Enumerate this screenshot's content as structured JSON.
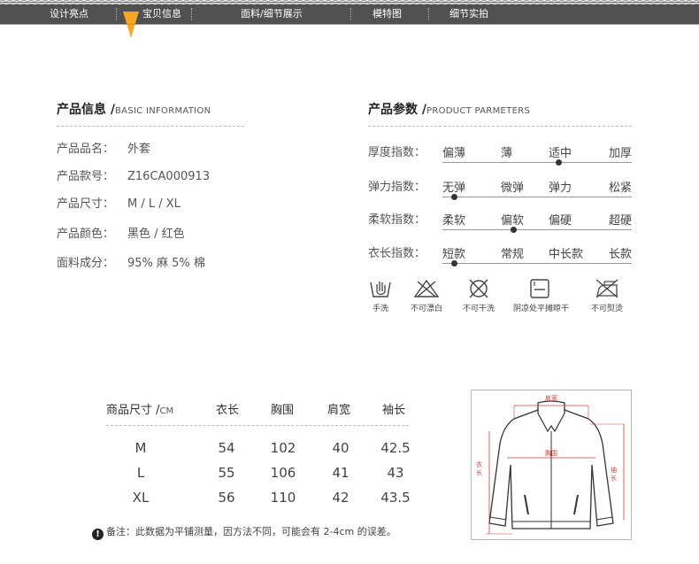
{
  "nav": {
    "items": [
      "设计亮点",
      "宝贝信息",
      "面料/细节展示",
      "模特图",
      "细节实拍"
    ],
    "active_index": 1
  },
  "basic_info": {
    "title": "产品信息 /",
    "subtitle": "BASIC INFORMATION",
    "rows": [
      {
        "label": "产品品名：",
        "value": "外套"
      },
      {
        "label": "产品款号：",
        "value": "Z16CA000913"
      },
      {
        "label": "产品尺寸：",
        "value": "M / L / XL"
      },
      {
        "label": "产品颜色：",
        "value": "黑色 / 红色"
      },
      {
        "label": "面料成分：",
        "value": "95% 麻 5% 棉"
      }
    ]
  },
  "product_params": {
    "title": "产品参数 /",
    "subtitle": "PRODUCT PARMETERS",
    "rows": [
      {
        "label": "厚度指数：",
        "options": [
          "偏薄",
          "薄",
          "适中",
          "加厚"
        ],
        "selected_index": 2
      },
      {
        "label": "弹力指数：",
        "options": [
          "无弹",
          "微弹",
          "弹力",
          "松紧"
        ],
        "selected_index": 0
      },
      {
        "label": "柔软指数：",
        "options": [
          "柔软",
          "偏软",
          "偏硬",
          "超硬"
        ],
        "selected_index": 1
      },
      {
        "label": "衣长指数：",
        "options": [
          "短款",
          "常规",
          "中长款",
          "长款"
        ],
        "selected_index": 0
      }
    ]
  },
  "care": [
    {
      "icon": "hand-wash-icon",
      "label": "手洗"
    },
    {
      "icon": "no-bleach-icon",
      "label": "不可漂白"
    },
    {
      "icon": "no-dry-clean-icon",
      "label": "不可干洗"
    },
    {
      "icon": "flat-dry-shade-icon",
      "label": "阴凉处平摊晾干"
    },
    {
      "icon": "no-iron-icon",
      "label": "不可熨烫"
    }
  ],
  "size_table": {
    "title": "商品尺寸 /",
    "unit": "CM",
    "headers": [
      "衣长",
      "胸围",
      "肩宽",
      "袖长"
    ],
    "rows": [
      {
        "size": "M",
        "values": [
          "54",
          "102",
          "40",
          "42.5"
        ]
      },
      {
        "size": "L",
        "values": [
          "55",
          "106",
          "41",
          "43"
        ]
      },
      {
        "size": "XL",
        "values": [
          "56",
          "110",
          "42",
          "43.5"
        ]
      }
    ]
  },
  "note": {
    "icon": "!",
    "text": "备注：此数据为平铺测量，因方法不同，可能会有 2-4cm 的误差。"
  },
  "diagram": {
    "shoulder": "肩宽",
    "chest": "胸围",
    "length": "衣长",
    "sleeve": "袖长"
  },
  "colors": {
    "nav_bg": "#515151",
    "accent": "#f5a623",
    "measure": "#d23c3c"
  }
}
